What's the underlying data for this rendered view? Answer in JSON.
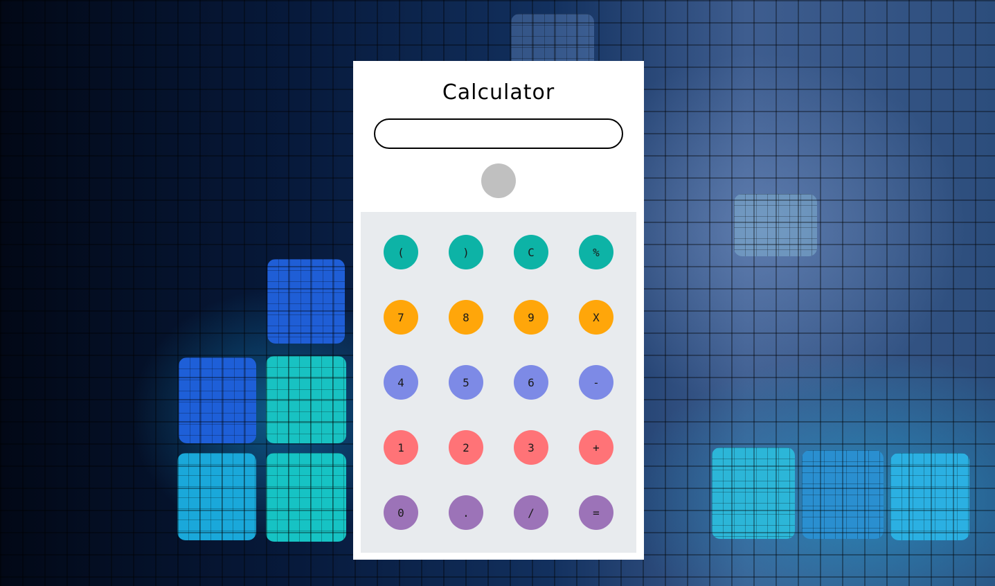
{
  "app": {
    "title": "Calculator"
  },
  "display": {
    "value": ""
  },
  "colors": {
    "teal": "#0db3a6",
    "orange": "#ffa60a",
    "blue": "#7d8ae6",
    "red": "#ff7377",
    "purple": "#9c73b8",
    "result_indicator": "#c0c0c0",
    "keypad_background": "#e8ebee"
  },
  "keys": [
    {
      "label": "(",
      "color": "teal"
    },
    {
      "label": ")",
      "color": "teal"
    },
    {
      "label": "C",
      "color": "teal"
    },
    {
      "label": "%",
      "color": "teal"
    },
    {
      "label": "7",
      "color": "orange"
    },
    {
      "label": "8",
      "color": "orange"
    },
    {
      "label": "9",
      "color": "orange"
    },
    {
      "label": "X",
      "color": "orange"
    },
    {
      "label": "4",
      "color": "blue"
    },
    {
      "label": "5",
      "color": "blue"
    },
    {
      "label": "6",
      "color": "blue"
    },
    {
      "label": "-",
      "color": "blue"
    },
    {
      "label": "1",
      "color": "red"
    },
    {
      "label": "2",
      "color": "red"
    },
    {
      "label": "3",
      "color": "red"
    },
    {
      "label": "+",
      "color": "red"
    },
    {
      "label": "0",
      "color": "purple"
    },
    {
      "label": ".",
      "color": "purple"
    },
    {
      "label": "/",
      "color": "purple"
    },
    {
      "label": "=",
      "color": "purple"
    }
  ]
}
